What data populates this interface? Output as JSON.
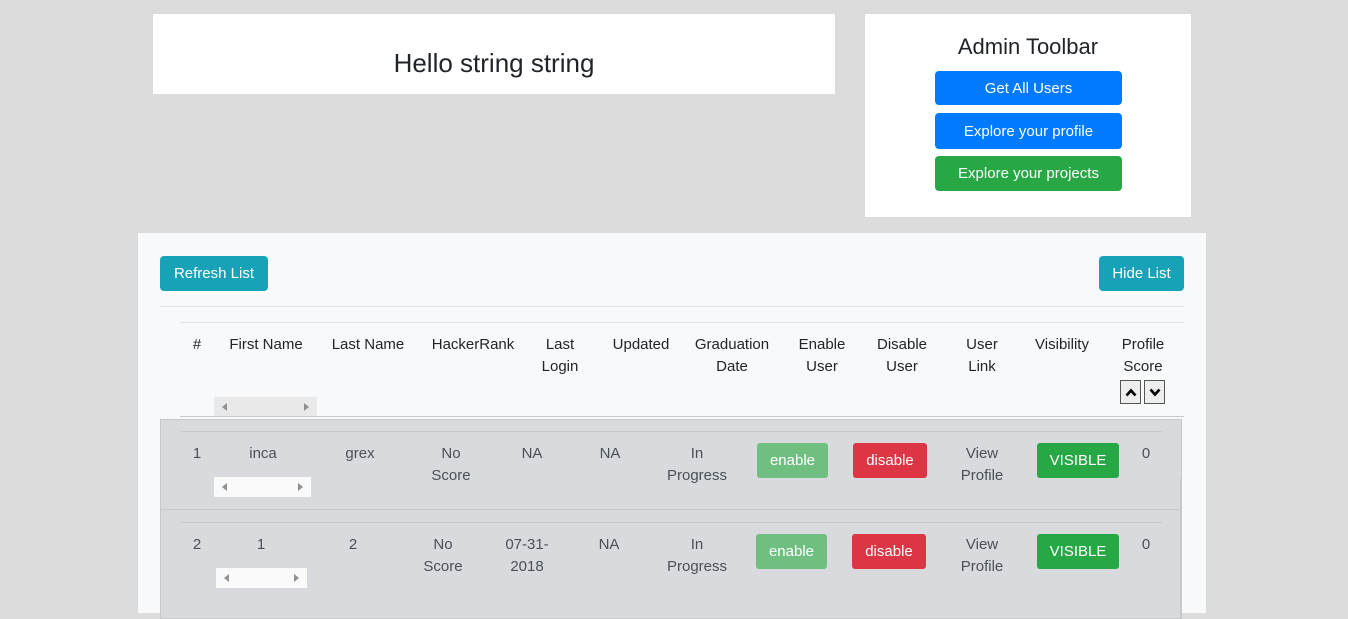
{
  "greeting": {
    "text": "Hello string string"
  },
  "admin_toolbar": {
    "title": "Admin Toolbar",
    "buttons": {
      "get_all_users": "Get All Users",
      "explore_profile": "Explore your profile",
      "explore_projects": "Explore your projects"
    }
  },
  "list_panel": {
    "refresh_label": "Refresh List",
    "hide_label": "Hide List",
    "headers": {
      "index": "#",
      "first_name": "First Name",
      "last_name": "Last Name",
      "hackerrank": "HackerRank",
      "last_login": "Last Login",
      "updated": "Updated",
      "graduation_date": "Graduation Date",
      "enable_user": "Enable User",
      "disable_user": "Disable User",
      "user_link": "User Link",
      "visibility": "Visibility",
      "profile_score": "Profile Score"
    },
    "rows": [
      {
        "index": "1",
        "first_name": "inca",
        "last_name": "grex",
        "hackerrank": "No Score",
        "last_login": "NA",
        "updated": "NA",
        "graduation": "In Progress",
        "enable": "enable",
        "disable": "disable",
        "link": "View Profile",
        "visibility": "VISIBLE",
        "score": "0"
      },
      {
        "index": "2",
        "first_name": "1",
        "last_name": "2",
        "hackerrank": "No Score",
        "last_login": "07-31-2018",
        "updated": "NA",
        "graduation": "In Progress",
        "enable": "enable",
        "disable": "disable",
        "link": "View Profile",
        "visibility": "VISIBLE",
        "score": "0"
      }
    ]
  },
  "colors": {
    "primary": "#007bff",
    "success": "#28a745",
    "info": "#17a2b8",
    "danger": "#dc3545",
    "background": "#dcdcdc"
  },
  "icons": {
    "sort_up": "chevron-up-icon",
    "sort_down": "chevron-down-icon",
    "scroll_left": "arrow-left-icon",
    "scroll_right": "arrow-right-icon"
  }
}
